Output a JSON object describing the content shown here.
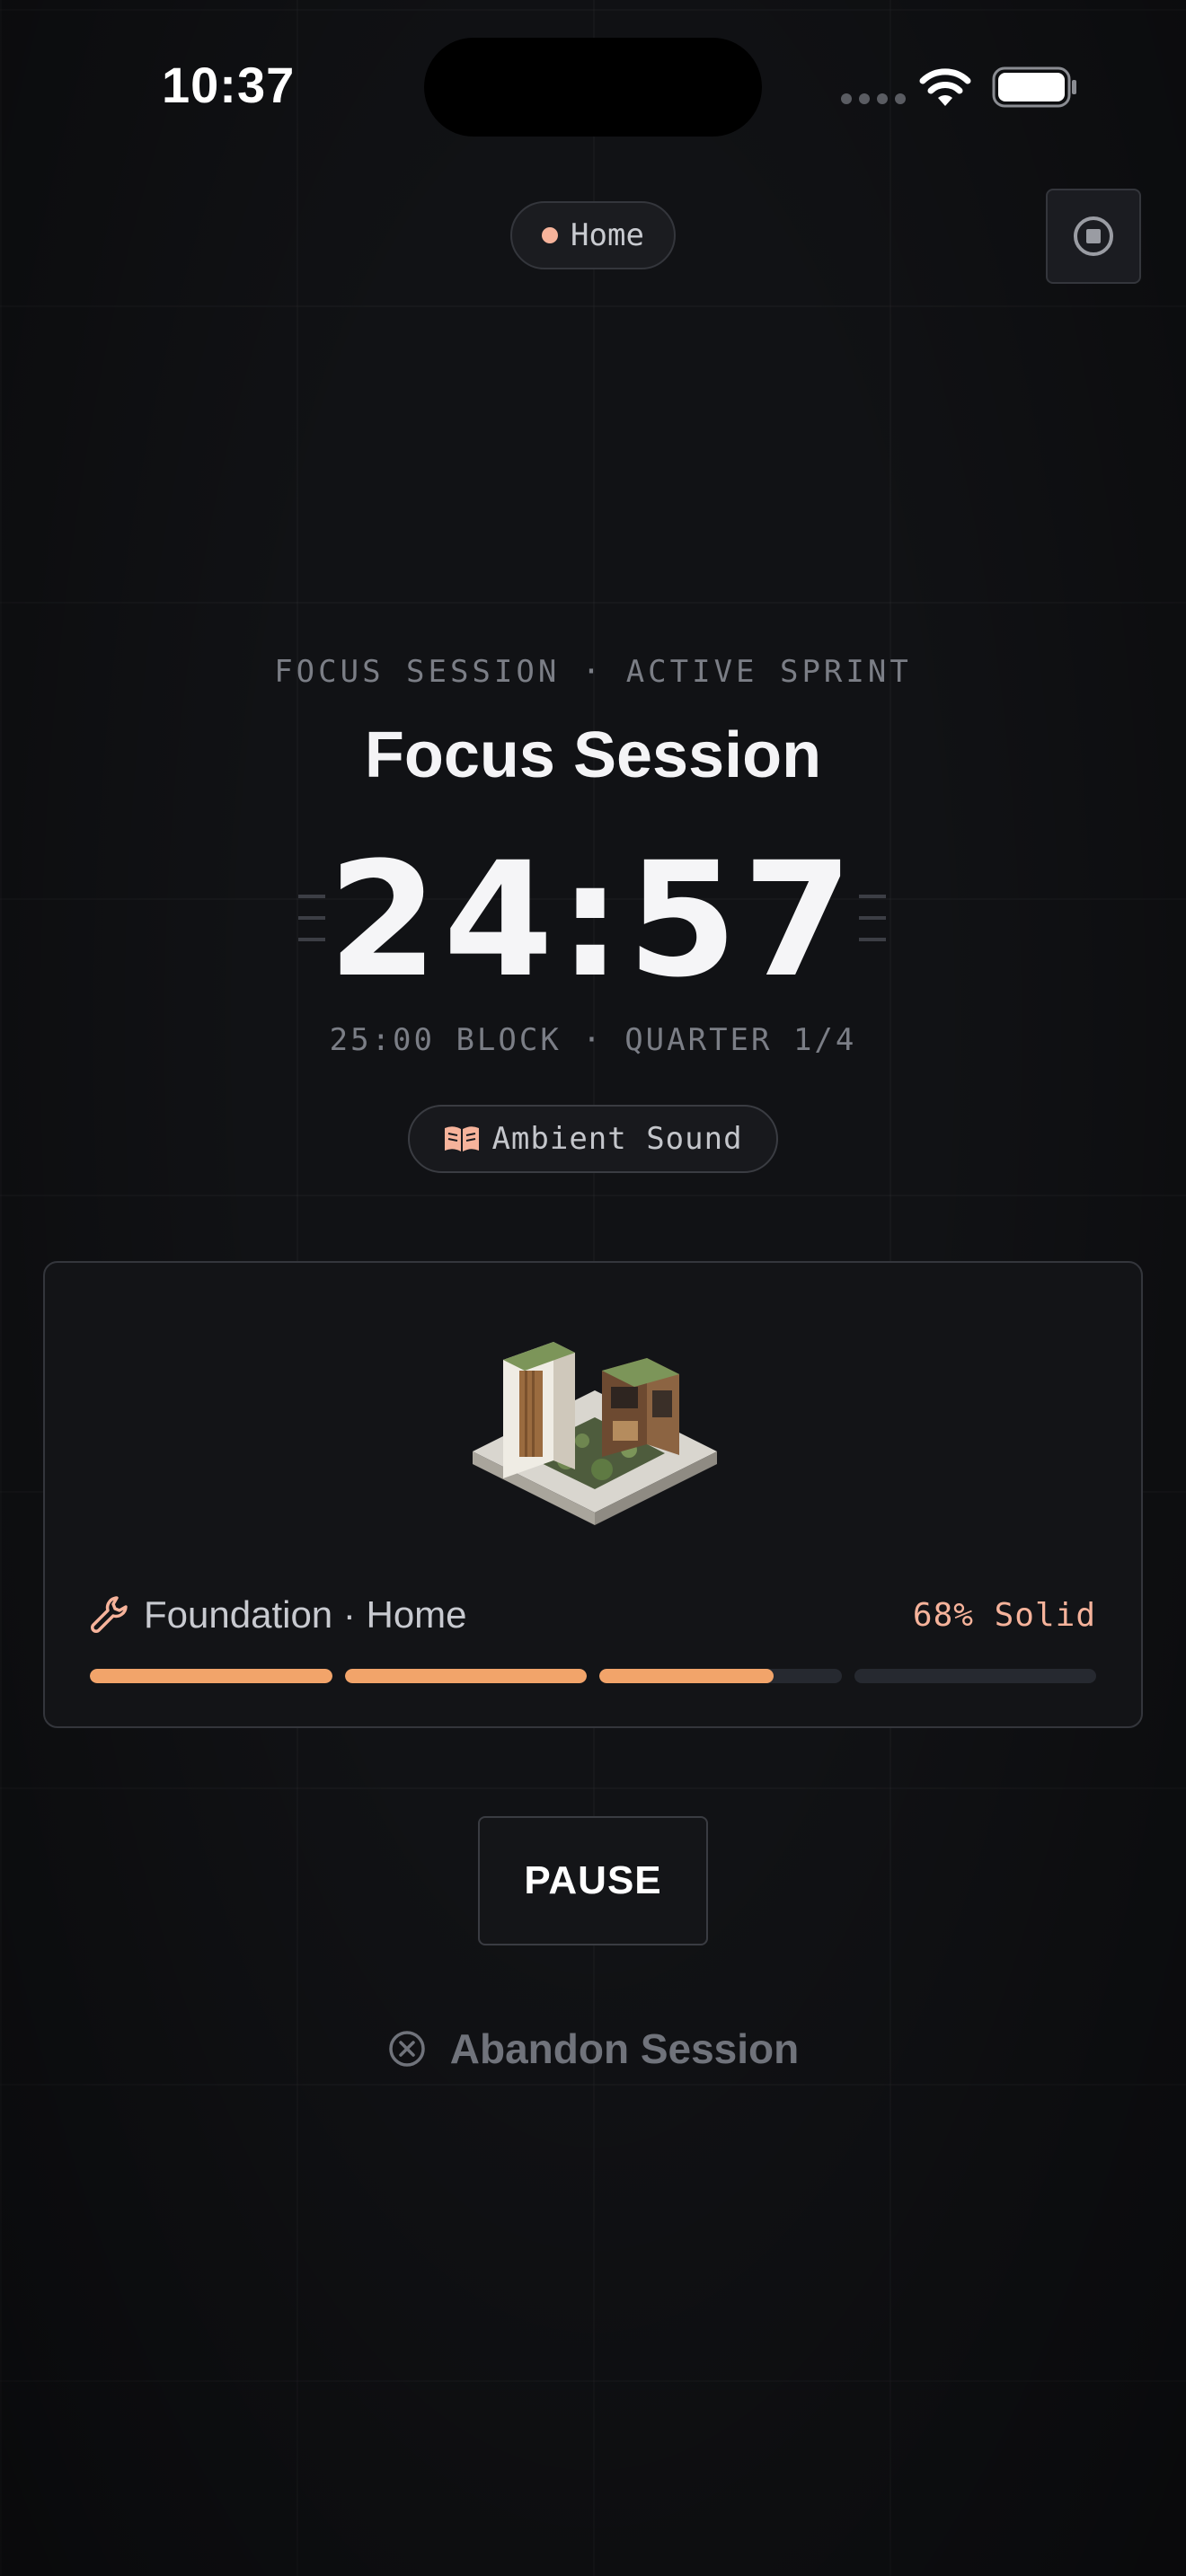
{
  "status_bar": {
    "time": "10:37"
  },
  "header": {
    "location_label": "Home",
    "location_dot_color": "#f6b39b"
  },
  "timer": {
    "kicker": "FOCUS SESSION · ACTIVE SPRINT",
    "title": "Focus Session",
    "remaining": "24:57",
    "block_info": "25:00 BLOCK · QUARTER 1/4"
  },
  "ambient": {
    "label": "Ambient Sound"
  },
  "project": {
    "name": "Foundation · Home",
    "progress_label": "68% Solid",
    "segments": [
      1,
      1,
      0.72,
      0
    ],
    "accent_color": "#f2a46a"
  },
  "actions": {
    "pause_label": "PAUSE",
    "abandon_label": "Abandon Session"
  },
  "icons": {
    "stop": "stop-icon",
    "wifi": "wifi-icon",
    "battery": "battery-icon",
    "book": "book-icon",
    "wrench": "wrench-icon",
    "close": "close-circle-icon"
  }
}
